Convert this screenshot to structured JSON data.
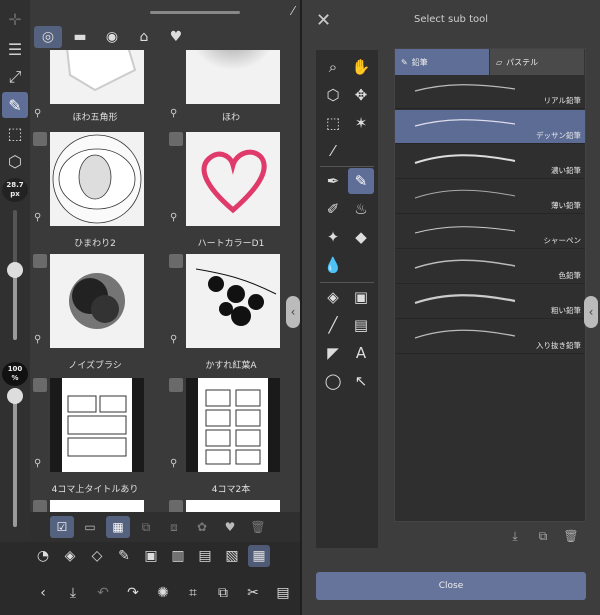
{
  "left_tools": {
    "size_value": "28.7",
    "size_unit": "px",
    "opacity_value": "100",
    "opacity_unit": "%"
  },
  "materials": {
    "tiles": [
      {
        "caption": "ほわ五角形"
      },
      {
        "caption": "ほわ"
      },
      {
        "caption": "ひまわり2"
      },
      {
        "caption": "ハートカラーD1"
      },
      {
        "caption": "ノイズブラシ"
      },
      {
        "caption": "かすれ紅葉A"
      },
      {
        "caption": "4コマ上タイトルあり"
      },
      {
        "caption": "4コマ2本"
      }
    ]
  },
  "sub_tool_dialog": {
    "title": "Select sub tool",
    "close_label": "Close",
    "groups": [
      {
        "label": "鉛筆",
        "active": true
      },
      {
        "label": "パステル",
        "active": false
      }
    ],
    "sub_tools": [
      {
        "label": "リアル鉛筆"
      },
      {
        "label": "デッサン鉛筆"
      },
      {
        "label": "濃い鉛筆"
      },
      {
        "label": "薄い鉛筆"
      },
      {
        "label": "シャーペン"
      },
      {
        "label": "色鉛筆"
      },
      {
        "label": "粗い鉛筆"
      },
      {
        "label": "入り抜き鉛筆"
      }
    ]
  },
  "colors": {
    "accent": "#5e6e96",
    "main_color": "#000000",
    "sub_color": "#ffffff"
  }
}
